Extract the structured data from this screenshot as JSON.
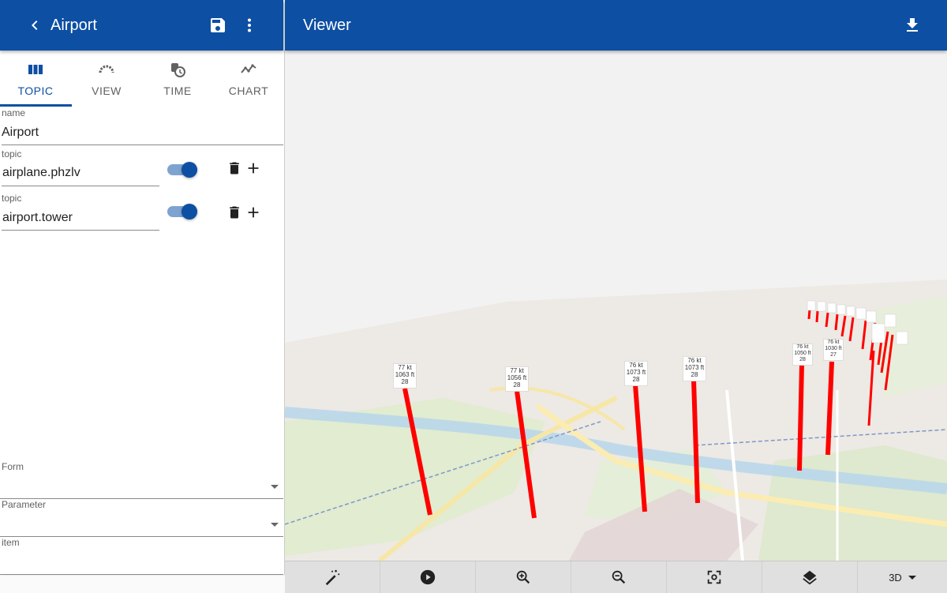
{
  "left_header": {
    "title": "Airport",
    "back_icon": "chevron-left-icon",
    "save_icon": "save-icon",
    "more_icon": "more-vert-icon"
  },
  "right_header": {
    "title": "Viewer",
    "download_icon": "download-icon"
  },
  "tabs": [
    {
      "label": "TOPIC",
      "icon": "columns-icon",
      "active": true
    },
    {
      "label": "VIEW",
      "icon": "gauge-icon",
      "active": false
    },
    {
      "label": "TIME",
      "icon": "time-history-icon",
      "active": false
    },
    {
      "label": "CHART",
      "icon": "line-chart-icon",
      "active": false
    }
  ],
  "name_field": {
    "label": "name",
    "value": "Airport"
  },
  "topics": [
    {
      "label": "topic",
      "value": "airplane.phzlv",
      "enabled": true
    },
    {
      "label": "topic",
      "value": "airport.tower",
      "enabled": true
    }
  ],
  "form_field": {
    "label": "Form",
    "value": ""
  },
  "parameter_field": {
    "label": "Parameter",
    "value": ""
  },
  "item_field": {
    "label": "item",
    "value": ""
  },
  "map_labels": [
    {
      "speed": "77 kt",
      "alt": "1063 ft",
      "num": "28"
    },
    {
      "speed": "77 kt",
      "alt": "1056 ft",
      "num": "28"
    },
    {
      "speed": "76 kt",
      "alt": "1073 ft",
      "num": "28"
    },
    {
      "speed": "76 kt",
      "alt": "1073 ft",
      "num": "28"
    },
    {
      "speed": "76 kt",
      "alt": "1050 ft",
      "num": "28"
    },
    {
      "speed": "76 kt",
      "alt": "1030 ft",
      "num": "27"
    }
  ],
  "toolbar": {
    "buttons": [
      "magic-wand-icon",
      "play-icon",
      "zoom-in-icon",
      "zoom-out-icon",
      "center-focus-icon",
      "layers-icon"
    ],
    "mode": "3D"
  },
  "colors": {
    "primary": "#0d4fa3",
    "track": "#ff0000"
  }
}
